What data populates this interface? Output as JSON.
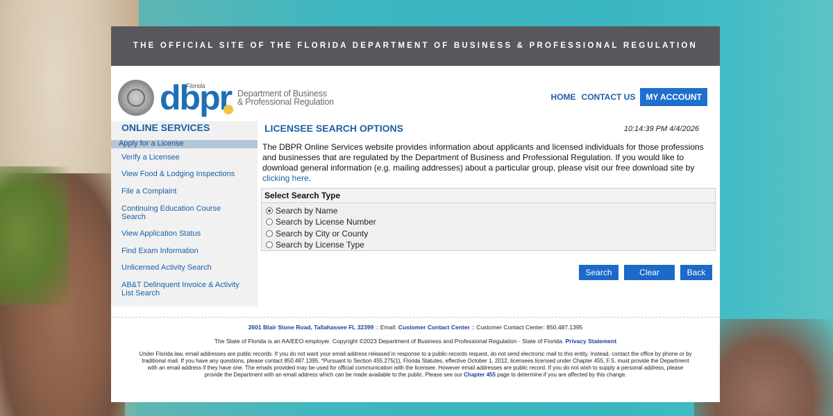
{
  "banner": "THE OFFICIAL SITE OF THE FLORIDA DEPARTMENT OF BUSINESS & PROFESSIONAL REGULATION",
  "logo": {
    "florida": "Florida",
    "dbpr": "dbpr",
    "dept_line1": "Department of Business",
    "dept_line2": "& Professional Regulation"
  },
  "nav": {
    "home": "HOME",
    "contact": "CONTACT US",
    "account": "MY ACCOUNT"
  },
  "sidebar": {
    "title": "ONLINE SERVICES",
    "items": [
      {
        "label": "Apply for a License"
      },
      {
        "label": "Verify a Licensee"
      },
      {
        "label": "View Food & Lodging Inspections"
      },
      {
        "label": "File a Complaint"
      },
      {
        "label": "Continuing Education Course Search"
      },
      {
        "label": "View Application Status"
      },
      {
        "label": "Find Exam Information"
      },
      {
        "label": "Unlicensed Activity Search"
      },
      {
        "label": "AB&T Delinquent Invoice & Activity List Search"
      }
    ]
  },
  "main": {
    "title": "LICENSEE SEARCH OPTIONS",
    "timestamp": "10:14:39 PM 4/4/2026",
    "intro": "The DBPR Online Services website provides information about applicants and licensed individuals for those professions and businesses that are regulated by the Department of Business and Professional Regulation. If you would like to download general information (e.g. mailing addresses) about a particular group, please visit our free download site by",
    "intro_link": "clicking here",
    "search_type_header": "Select Search Type",
    "options": [
      {
        "label": "Search by Name",
        "checked": true
      },
      {
        "label": "Search by License Number",
        "checked": false
      },
      {
        "label": "Search by City or County",
        "checked": false
      },
      {
        "label": "Search by License Type",
        "checked": false
      }
    ],
    "buttons": {
      "search": "Search",
      "clear": "Clear",
      "back": "Back"
    }
  },
  "footer": {
    "address": "2601 Blair Stone Road, Tallahassee FL 32399",
    "sep1": " :: Email: ",
    "email_link": "Customer Contact Center",
    "sep2": " :: Customer Contact Center: 850.487.1395",
    "copyright": "The State of Florida is an AA/EEO employer. Copyright ©2023 Department of Business and Professional Regulation - State of Florida. ",
    "privacy": "Privacy Statement",
    "legal_1": "Under Florida law, email addresses are public records. If you do not want your email address released in response to a public-records request, do not send electronic mail to this entity. Instead, contact the office by phone or by traditional mail. If you have any questions, please contact 850.487.1395. *Pursuant to Section 455.275(1), Florida Statutes, effective October 1, 2012, licensees licensed under Chapter 455, F.S. must provide the Department with an email address if they have one. The emails provided may be used for official communication with the licensee. However email addresses are public record. If you do not wish to supply a personal address, please provide the Department with an email address which can be made available to the public. Please see our ",
    "chapter_link": "Chapter 455",
    "legal_2": " page to determine if you are affected by this change."
  }
}
